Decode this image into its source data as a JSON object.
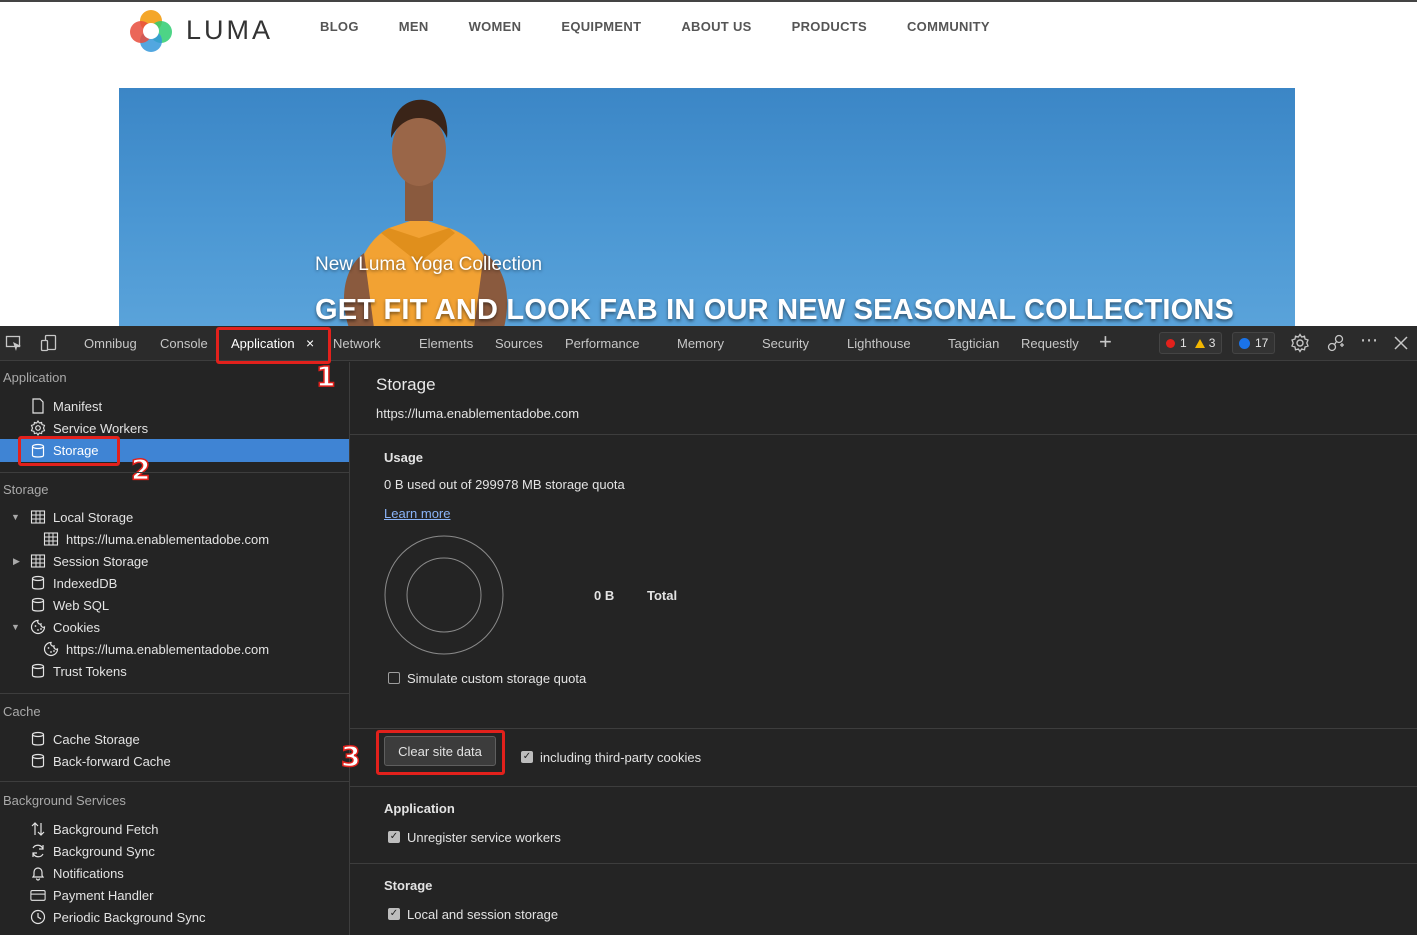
{
  "site": {
    "logo_text": "LUMA",
    "nav": [
      "BLOG",
      "MEN",
      "WOMEN",
      "EQUIPMENT",
      "ABOUT US",
      "PRODUCTS",
      "COMMUNITY"
    ],
    "hero_subtitle": "New Luma Yoga Collection",
    "hero_title": "GET FIT AND LOOK FAB IN OUR NEW SEASONAL COLLECTIONS"
  },
  "devtools": {
    "tabs": {
      "omnibug": "Omnibug",
      "console": "Console",
      "application": "Application",
      "network": "Network",
      "elements": "Elements",
      "sources": "Sources",
      "performance": "Performance",
      "memory": "Memory",
      "security": "Security",
      "lighthouse": "Lighthouse",
      "tagtician": "Tagtician",
      "requestly": "Requestly"
    },
    "close_tab_glyph": "×",
    "add_tab_glyph": "+",
    "badges": {
      "errors": "1",
      "warnings": "3",
      "messages": "17"
    },
    "annotations": {
      "one": "1",
      "two": "2",
      "three": "3"
    },
    "sidebar": {
      "application_header": "Application",
      "manifest": "Manifest",
      "service_workers": "Service Workers",
      "storage_item": "Storage",
      "storage_header": "Storage",
      "local_storage": "Local Storage",
      "local_storage_origin": "https://luma.enablementadobe.com",
      "session_storage": "Session Storage",
      "indexeddb": "IndexedDB",
      "web_sql": "Web SQL",
      "cookies": "Cookies",
      "cookies_origin": "https://luma.enablementadobe.com",
      "trust_tokens": "Trust Tokens",
      "cache_header": "Cache",
      "cache_storage": "Cache Storage",
      "back_forward_cache": "Back-forward Cache",
      "bg_header": "Background Services",
      "background_fetch": "Background Fetch",
      "background_sync": "Background Sync",
      "notifications": "Notifications",
      "payment_handler": "Payment Handler",
      "periodic_background_sync": "Periodic Background Sync"
    },
    "main": {
      "title": "Storage",
      "origin": "https://luma.enablementadobe.com",
      "usage_heading": "Usage",
      "usage_text": "0 B used out of 299978 MB storage quota",
      "learn_more": "Learn more",
      "total_value": "0 B",
      "total_label": "Total",
      "simulate_label": "Simulate custom storage quota",
      "simulate_checked": false,
      "clear_button": "Clear site data",
      "third_party_label": "including third-party cookies",
      "third_party_checked": true,
      "application_heading": "Application",
      "unregister_label": "Unregister service workers",
      "unregister_checked": true,
      "storage_heading": "Storage",
      "local_session_label": "Local and session storage",
      "local_session_checked": true
    }
  },
  "colors": {
    "devtools_bg": "#242424",
    "selected_row": "#3f84d4",
    "annotation_red": "#e2211c",
    "link_blue": "#8ab4f8"
  }
}
